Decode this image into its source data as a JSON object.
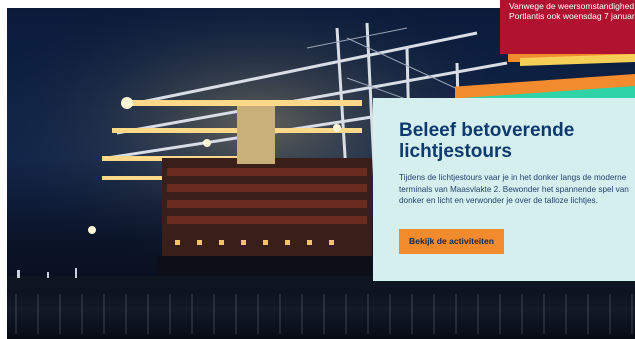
{
  "alert": {
    "line1": "Vanwege de weersomstandighed",
    "line2": "Portlantis ook woensdag 7 januari"
  },
  "promo": {
    "title": "Beleef betoverende lichtjestours",
    "body": "Tijdens de lichtjestours vaar je in het donker langs de moderne terminals van Maasvlakte 2. Bewonder het spannende spel van donker en licht en verwonder je over de talloze lichtjes.",
    "cta_label": "Bekijk de activiteiten"
  },
  "colors": {
    "alert_red": "#b0122f",
    "card_bg": "#d5efee",
    "title_navy": "#0e3a6e",
    "cta_orange": "#f28a2e",
    "stripe_yellow": "#f6cf56",
    "stripe_orange": "#f28a2e",
    "stripe_teal": "#2ed3a8"
  }
}
